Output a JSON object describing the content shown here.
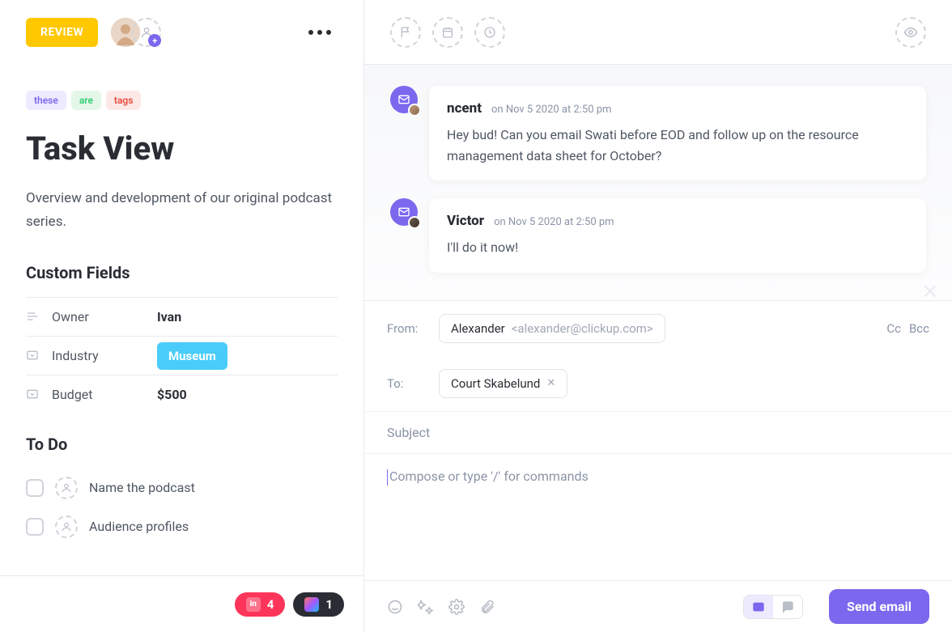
{
  "status": "REVIEW",
  "tags": [
    "these",
    "are",
    "tags"
  ],
  "title": "Task View",
  "description": "Overview and development of our original podcast series.",
  "customFieldsHeading": "Custom Fields",
  "cf": {
    "owner": {
      "label": "Owner",
      "value": "Ivan"
    },
    "industry": {
      "label": "Industry",
      "value": "Museum"
    },
    "budget": {
      "label": "Budget",
      "value": "$500"
    }
  },
  "todoHeading": "To Do",
  "todos": [
    {
      "text": "Name the podcast"
    },
    {
      "text": "Audience profiles"
    }
  ],
  "chips": {
    "invision": "4",
    "figma": "1"
  },
  "messages": [
    {
      "name": "ncent",
      "time": "on Nov 5 2020 at 2:50 pm",
      "body": "Hey bud! Can you email Swati before EOD and follow up on the resource management data sheet for October?"
    },
    {
      "name": "Victor",
      "time": "on Nov 5 2020 at 2:50 pm",
      "body": "I'll do it now!"
    }
  ],
  "compose": {
    "fromLabel": "From:",
    "fromName": "Alexander",
    "fromEmail": "<alexander@clickup.com>",
    "toLabel": "To:",
    "toName": "Court Skabelund",
    "cc": "Cc",
    "bcc": "Bcc",
    "subjectPlaceholder": "Subject",
    "bodyPlaceholder": "Compose or type '/' for commands",
    "sendLabel": "Send email"
  }
}
